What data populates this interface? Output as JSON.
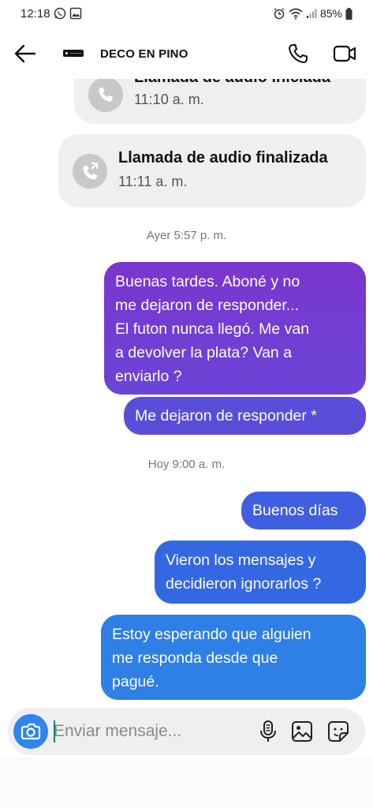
{
  "status_bar": {
    "time": "12:18",
    "battery": "85%",
    "icons": [
      "whatsapp-icon",
      "image-icon",
      "alarm-icon",
      "wifi-icon",
      "signal-icon",
      "battery-icon"
    ]
  },
  "header": {
    "contact_name": "DECO EN PINO",
    "icons": [
      "back-arrow-icon",
      "phone-icon",
      "video-camera-icon"
    ]
  },
  "thread": {
    "call_events": [
      {
        "title": "Llamada de audio iniciada",
        "time": "11:10 a. m."
      },
      {
        "title": "Llamada de audio finalizada",
        "time": "11:11 a. m."
      }
    ],
    "timestamps": [
      "Ayer 5:57 p. m.",
      "Hoy 9:00 a. m."
    ],
    "messages": [
      {
        "lines": [
          "Buenas tardes. Aboné y no",
          "me dejaron de responder...",
          "El futon nunca llegó. Me van",
          "a devolver la plata? Van a",
          "enviarlo ?"
        ]
      },
      {
        "lines": [
          "Me dejaron de responder *"
        ]
      },
      {
        "lines": [
          "Buenos días"
        ]
      },
      {
        "lines": [
          "Vieron los mensajes y",
          "decidieron ignorarlos ?"
        ]
      },
      {
        "lines": [
          "Estoy esperando que alguien",
          "me responda desde que",
          "pagué."
        ]
      }
    ]
  },
  "composer": {
    "placeholder": "Enviar mensaje...",
    "icons": [
      "camera-icon",
      "microphone-icon",
      "gallery-icon",
      "sticker-icon"
    ]
  },
  "colors": {
    "bubble_purple": "#7b3fd1",
    "bubble_indigo": "#5a4ed8",
    "bubble_blue": "#3566e0",
    "bubble_light_blue": "#2e7fe6",
    "call_card": "#efefef",
    "camera_button": "#2f84f0"
  }
}
